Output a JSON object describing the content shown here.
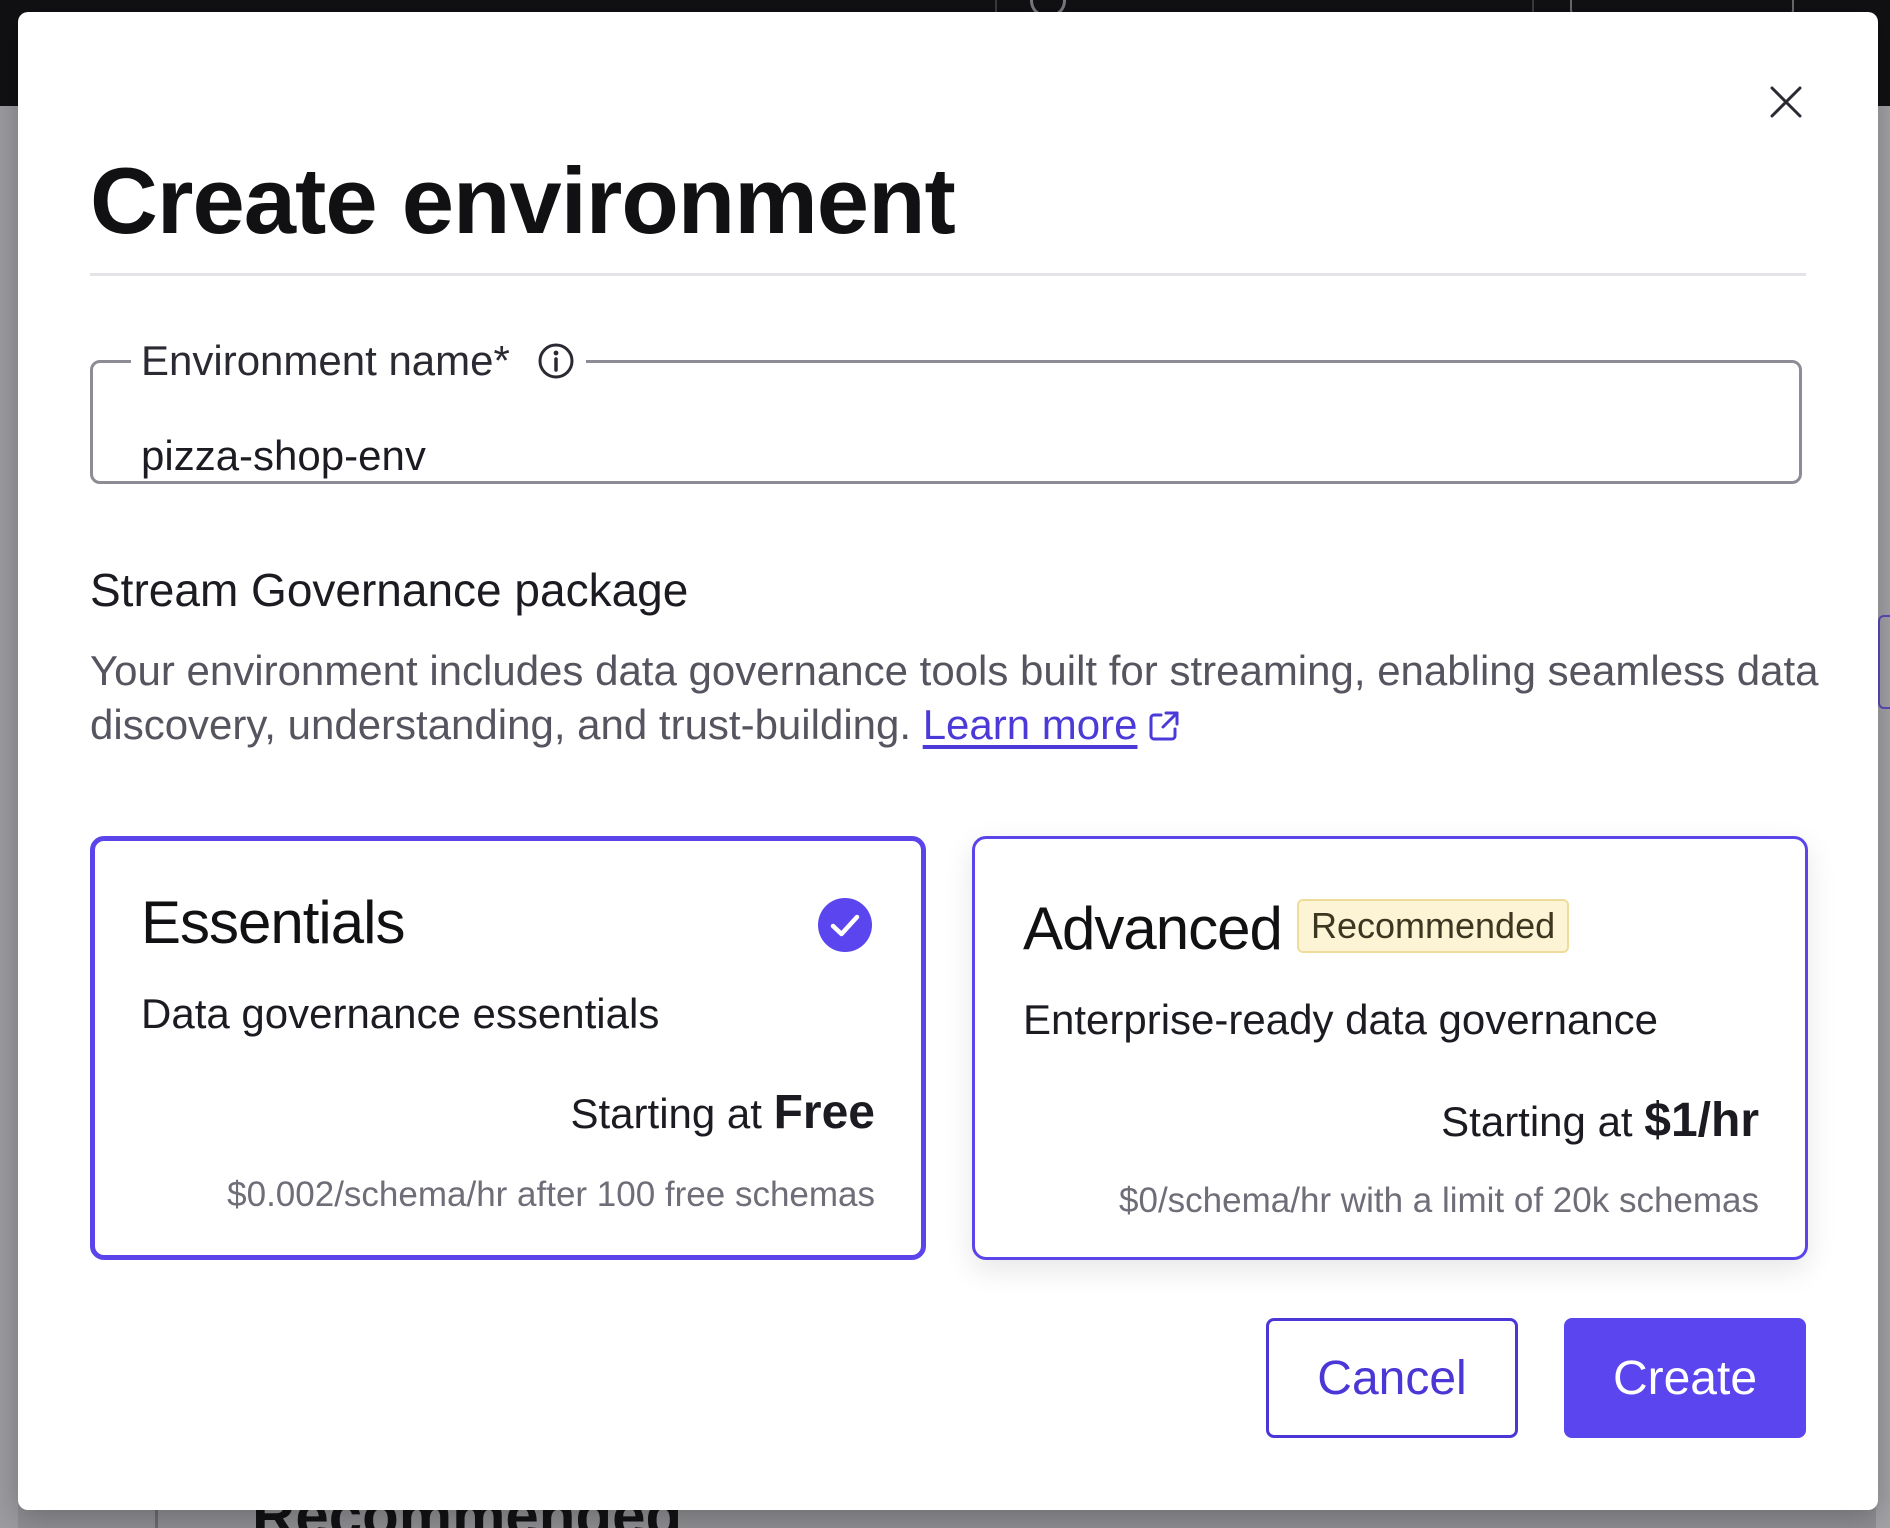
{
  "modal": {
    "title": "Create environment",
    "close_label": "×"
  },
  "field": {
    "label": "Environment name*",
    "value": "pizza-shop-env"
  },
  "governance": {
    "heading": "Stream Governance package",
    "description": "Your environment includes data governance tools built for streaming, enabling seamless data discovery, understanding, and trust-building. ",
    "learn_more": "Learn more"
  },
  "packages": [
    {
      "name": "Essentials",
      "selected": true,
      "description": "Data governance essentials",
      "price_prefix": "Starting at ",
      "price": "Free",
      "note": "$0.002/schema/hr after 100 free schemas"
    },
    {
      "name": "Advanced",
      "selected": false,
      "badge": "Recommended",
      "description": "Enterprise-ready data governance",
      "price_prefix": "Starting at ",
      "price": "$1/hr",
      "note": "$0/schema/hr with a limit of 20k schemas"
    }
  ],
  "footer": {
    "cancel_label": "Cancel",
    "create_label": "Create"
  },
  "background": {
    "partial_heading": "Recommended"
  },
  "colors": {
    "accent": "#5a45ef",
    "badge_bg": "#fcf4d5",
    "link": "#4c3ad8"
  }
}
